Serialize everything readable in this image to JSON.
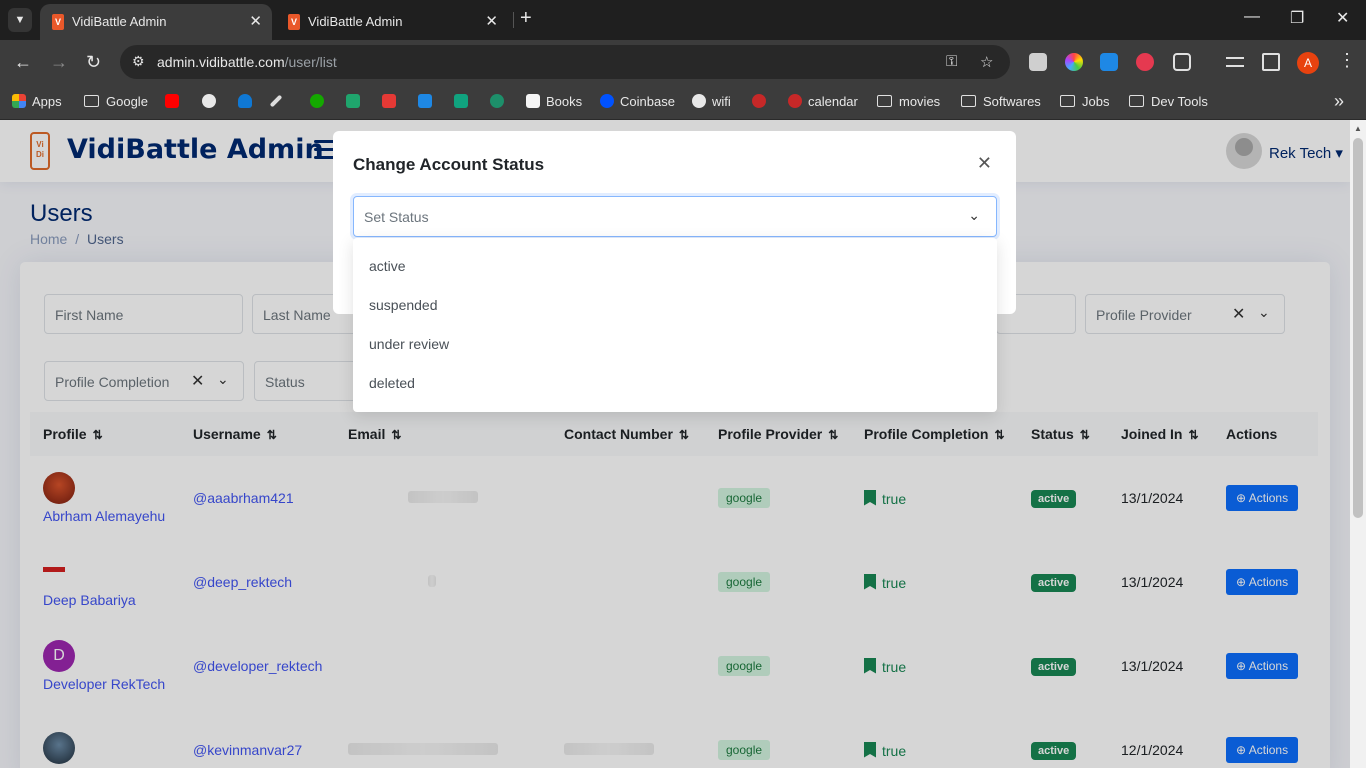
{
  "browser": {
    "tabs": [
      {
        "title": "VidiBattle Admin",
        "active": true
      },
      {
        "title": "VidiBattle Admin",
        "active": false
      }
    ],
    "url_host": "admin.vidibattle.com",
    "url_path": "/user/list",
    "profile_initial": "A",
    "bookmarks": [
      "Apps",
      "Google",
      "Books",
      "Coinbase",
      "wifi",
      "calendar",
      "movies",
      "Softwares",
      "Jobs",
      "Dev Tools"
    ]
  },
  "app": {
    "brand": "VidiBattle Admin",
    "user_name": "Rek Tech",
    "page_title": "Users",
    "breadcrumb": {
      "home": "Home",
      "sep": "/",
      "current": "Users"
    },
    "filters": {
      "first_name": "First Name",
      "last_name": "Last Name",
      "profile_provider": "Profile Provider",
      "profile_completion": "Profile Completion",
      "status": "Status"
    },
    "table": {
      "headers": [
        "Profile",
        "Username",
        "Email",
        "Contact Number",
        "Profile Provider",
        "Profile Completion",
        "Status",
        "Joined In",
        "Actions"
      ],
      "rows": [
        {
          "name": "Abrham Alemayehu",
          "username": "@aaabrham421",
          "provider": "google",
          "completion": "true",
          "status": "active",
          "joined": "13/1/2024",
          "action": "Actions"
        },
        {
          "name": "Deep Babariya",
          "username": "@deep_rektech",
          "provider": "google",
          "completion": "true",
          "status": "active",
          "joined": "13/1/2024",
          "action": "Actions"
        },
        {
          "name": "Developer RekTech",
          "avatar_letter": "D",
          "username": "@developer_rektech",
          "provider": "google",
          "completion": "true",
          "status": "active",
          "joined": "13/1/2024",
          "action": "Actions"
        },
        {
          "name": "",
          "username": "@kevinmanvar27",
          "provider": "google",
          "completion": "true",
          "status": "active",
          "joined": "12/1/2024",
          "action": "Actions"
        }
      ]
    }
  },
  "modal": {
    "title": "Change Account Status",
    "select_placeholder": "Set Status",
    "options": [
      "active",
      "suspended",
      "under review",
      "deleted"
    ]
  },
  "colors": {
    "brand": "#012970",
    "link": "#4154f1",
    "primary": "#0d6efd",
    "success": "#198754"
  }
}
